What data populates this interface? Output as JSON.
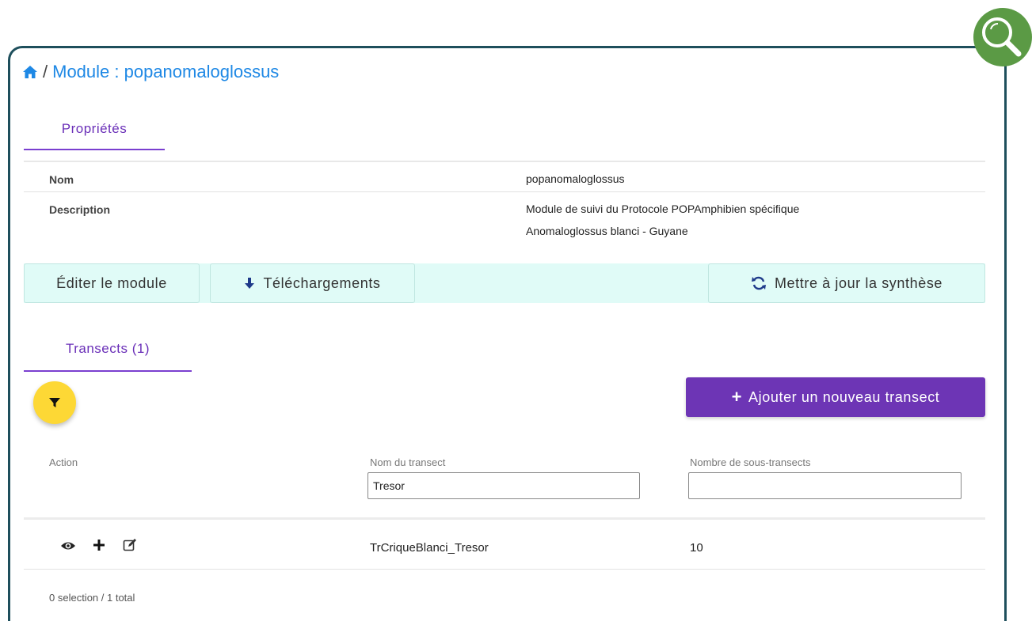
{
  "breadcrumb": {
    "home_icon": "home-icon",
    "separator": "/",
    "title": "Module : popanomaloglossus"
  },
  "tabs": {
    "properties": "Propriétés",
    "transects": "Transects (1)"
  },
  "properties": [
    {
      "label": "Nom",
      "value": "popanomaloglossus"
    },
    {
      "label": "Description",
      "value_line1": "Module de suivi du Protocole POPAmphibien spécifique",
      "value_line2": "Anomaloglossus blanci - Guyane"
    }
  ],
  "actions": {
    "edit": "Éditer le module",
    "downloads": "Téléchargements",
    "update_synthesis": "Mettre à jour la synthèse"
  },
  "transects": {
    "add_button": "Ajouter un nouveau transect",
    "columns": {
      "action": "Action",
      "name": "Nom du transect",
      "sub_count": "Nombre de sous-transects"
    },
    "filters": {
      "name_value": "Tresor",
      "sub_count_value": ""
    },
    "rows": [
      {
        "name": "TrCriqueBlanci_Tresor",
        "sub_count": "10"
      }
    ],
    "footer": "0 selection / 1 total"
  },
  "colors": {
    "link": "#1e88e5",
    "tab_accent": "#7a3fd0",
    "primary_button": "#6d35b5",
    "action_bar": "#e0fbf7",
    "filter_fab": "#fdd835",
    "frame_border": "#1e4f5c",
    "badge": "#5b9a45"
  }
}
